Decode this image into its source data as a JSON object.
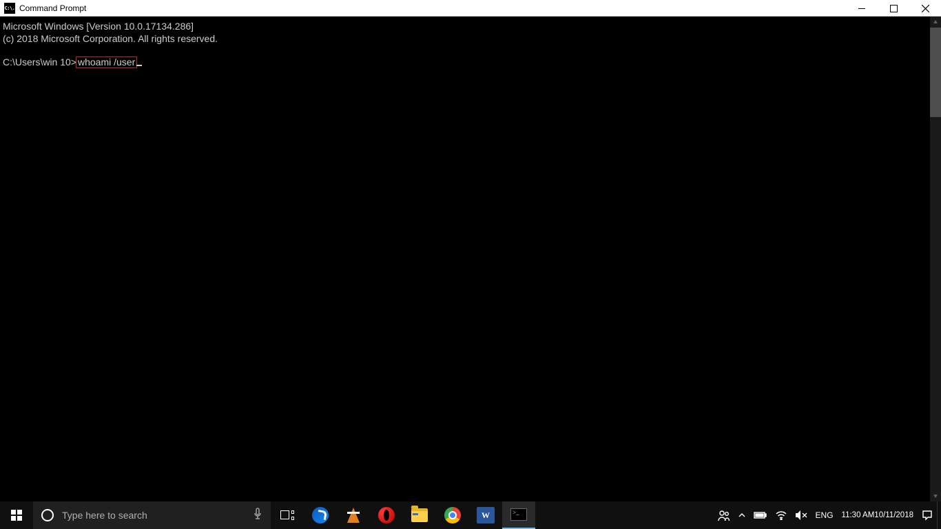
{
  "window": {
    "title": "Command Prompt",
    "icon_text": "C:\\."
  },
  "console": {
    "line1": "Microsoft Windows [Version 10.0.17134.286]",
    "line2": "(c) 2018 Microsoft Corporation. All rights reserved.",
    "prompt_path": "C:\\Users\\win 10>",
    "typed_command": "whoami /user"
  },
  "taskbar": {
    "search_placeholder": "Type here to search",
    "language": "ENG",
    "time": "11:30 AM",
    "date": "10/11/2018",
    "word_label": "W"
  }
}
